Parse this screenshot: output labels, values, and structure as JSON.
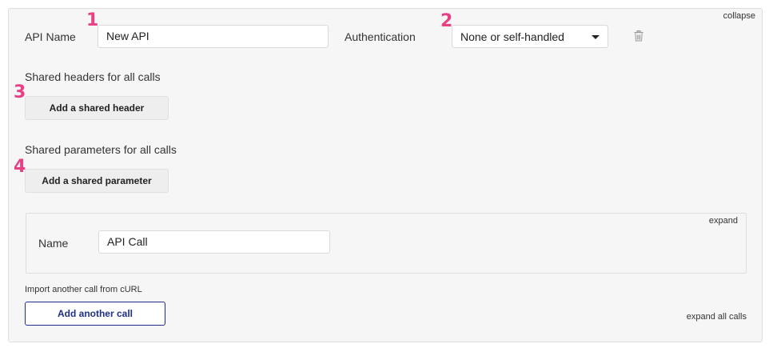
{
  "api": {
    "collapse_label": "collapse",
    "name_label": "API Name",
    "name_value": "New API",
    "auth_label": "Authentication",
    "auth_selected": "None or self-handled"
  },
  "shared_headers": {
    "title": "Shared headers for all calls",
    "add_label": "Add a shared header"
  },
  "shared_params": {
    "title": "Shared parameters for all calls",
    "add_label": "Add a shared parameter"
  },
  "call": {
    "expand_label": "expand",
    "name_label": "Name",
    "name_value": "API Call"
  },
  "footer": {
    "import_label": "Import another call from cURL",
    "add_call_label": "Add another call",
    "expand_all_label": "expand all calls"
  },
  "markers": [
    "1",
    "2",
    "3",
    "4"
  ],
  "icons": {
    "delete": "trash-icon"
  },
  "colors": {
    "marker": "#ea3f84",
    "primary": "#1f2f8a"
  }
}
